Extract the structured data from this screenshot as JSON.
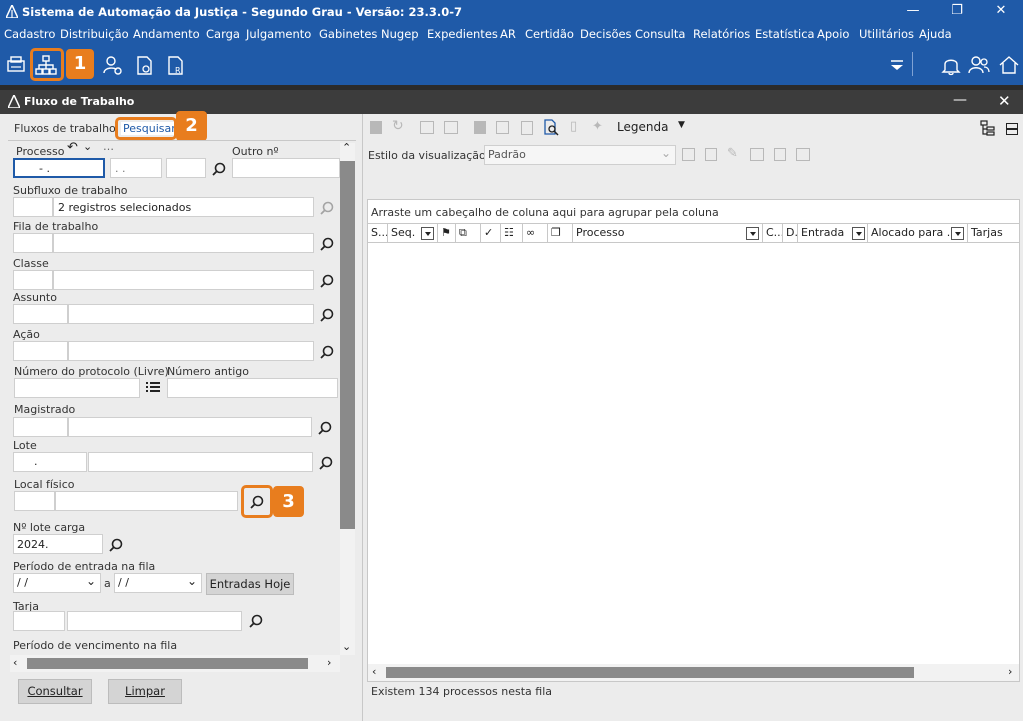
{
  "app": {
    "title": "Sistema de Automação da Justiça - Segundo Grau - Versão: 23.3.0-7"
  },
  "menu": [
    "Cadastro",
    "Distribuição",
    "Andamento",
    "Carga",
    "Julgamento",
    "Gabinetes",
    "Nugep",
    "Expedientes",
    "AR",
    "Certidão",
    "Decisões",
    "Consulta",
    "Relatórios",
    "Estatística",
    "Apoio",
    "Utilitários",
    "Ajuda"
  ],
  "callouts": [
    "1",
    "2",
    "3"
  ],
  "window": {
    "title": "Fluxo de Trabalho"
  },
  "tabs": {
    "fluxos": "Fluxos de trabalho",
    "pesquisar": "Pesquisar"
  },
  "form": {
    "processo_label": "Processo",
    "processo_value": "- .",
    "processo_part2": ". .",
    "outro_label": "Outro nº",
    "subfluxo_label": "Subfluxo de trabalho",
    "subfluxo_value": "2 registros selecionados",
    "fila_label": "Fila de trabalho",
    "classe_label": "Classe",
    "assunto_label": "Assunto",
    "acao_label": "Ação",
    "protocolo_label": "Número do protocolo (Livre)",
    "antigo_label": "Número antigo",
    "magistrado_label": "Magistrado",
    "lote_label": "Lote",
    "lote_value": ".",
    "local_label": "Local físico",
    "lote_carga_label": "Nº lote carga",
    "lote_carga_value": "2024.",
    "periodo_entrada_label": "Período de entrada na fila",
    "date_from": " / /",
    "date_sep": "a",
    "date_to": " / /",
    "entradas_hoje": "Entradas Hoje",
    "tarja_label": "Tarja",
    "periodo_venc_label": "Período de vencimento na fila",
    "consultar": "Consultar",
    "limpar": "Limpar"
  },
  "right": {
    "legenda": "Legenda",
    "estilo_label": "Estilo da visualização",
    "estilo_value": "Padrão",
    "group_hint": "Arraste um cabeçalho de coluna aqui para agrupar pela coluna",
    "columns": [
      "S...",
      "Seq.",
      "Processo",
      "C...",
      "D...",
      "Entrada",
      "Alocado para ...",
      "Tarjas"
    ],
    "status": "Existem 134 processos nesta fila"
  },
  "colors": {
    "accent": "#1f5aa8",
    "callout": "#e87d1e"
  }
}
